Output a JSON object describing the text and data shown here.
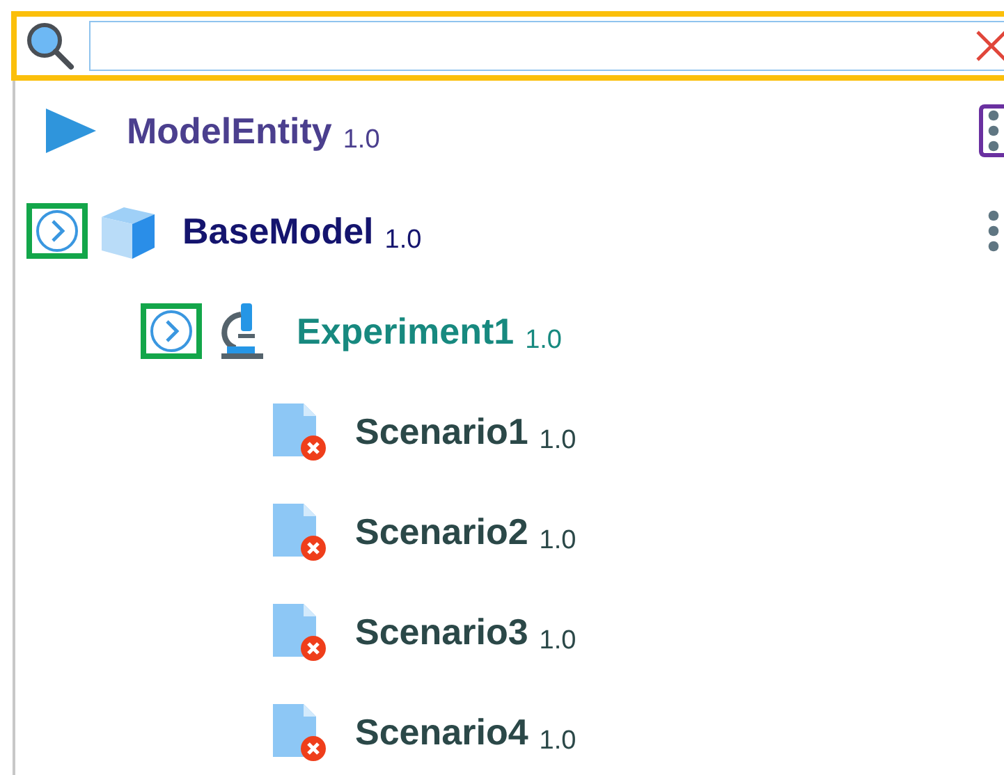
{
  "search": {
    "highlighted": true
  },
  "tree": [
    {
      "name": "ModelEntity",
      "version": "1.0",
      "kind": "entity",
      "color": "#4b3f8e",
      "menu": {
        "highlighted": true
      }
    },
    {
      "name": "BaseModel",
      "version": "1.0",
      "kind": "model",
      "color": "#14146e",
      "expander": {
        "highlighted": true
      },
      "menu": {
        "highlighted": false
      },
      "children": [
        {
          "name": "Experiment1",
          "version": "1.0",
          "kind": "experiment",
          "color": "#17897f",
          "expander": {
            "highlighted": true
          },
          "children": [
            {
              "name": "Scenario1",
              "version": "1.0",
              "kind": "scenario",
              "color": "#2b4848",
              "error": true
            },
            {
              "name": "Scenario2",
              "version": "1.0",
              "kind": "scenario",
              "color": "#2b4848",
              "error": true
            },
            {
              "name": "Scenario3",
              "version": "1.0",
              "kind": "scenario",
              "color": "#2b4848",
              "error": true
            },
            {
              "name": "Scenario4",
              "version": "1.0",
              "kind": "scenario",
              "color": "#2b4848",
              "error": true
            }
          ]
        }
      ]
    }
  ]
}
